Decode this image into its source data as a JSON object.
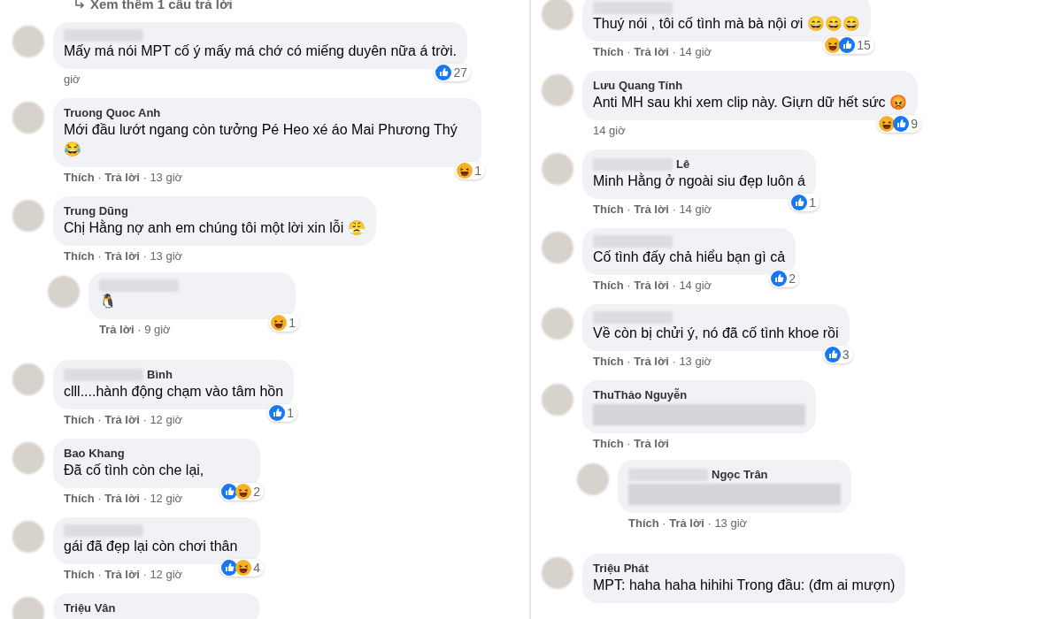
{
  "columns": [
    {
      "more_replies": {
        "label": "Xem thêm 1 câu trả lời"
      },
      "comments": [
        {
          "author_hidden": true,
          "text": "Mấy má nói MPT cố ý mấy má chớ có miếng duyên nữa á trời.",
          "reactions": {
            "icons": [
              {
                "kind": "like"
              }
            ],
            "count": "27"
          },
          "actions": "giờ"
        },
        {
          "author": "Truong Quoc Anh",
          "text": "Mới đầu lướt ngang còn tưởng Pé Heo xé áo Mai Phương Thý 😂",
          "reactions": {
            "icons": [
              {
                "kind": "haha"
              }
            ],
            "count": "1"
          },
          "actions": "**Thích** · **Trả lời** · 13 giờ"
        },
        {
          "author": "Trung Dũng",
          "text": "Chị Hằng nợ anh em chúng tôi một lời xin lỗi 😤",
          "actions": "**Thích** · **Trả lời** · 13 giờ",
          "children": [
            {
              "author_hidden": true,
              "text": "🐧",
              "reactions": {
                "icons": [
                  {
                    "kind": "haha"
                  }
                ],
                "count": "1"
              },
              "actions": "**Trả lời** · 9 giờ"
            }
          ]
        },
        {
          "author": "Bình",
          "author_hidden": true,
          "text": "clll....hành động chạm vào tâm hồn",
          "reactions": {
            "icons": [
              {
                "kind": "like"
              }
            ],
            "count": "1"
          },
          "actions": "**Thích** · **Trả lời** · 12 giờ"
        },
        {
          "author": "Bao Khang",
          "text": "Đã cố tình còn che lại,",
          "reactions": {
            "icons": [
              {
                "kind": "like"
              },
              {
                "kind": "haha"
              }
            ],
            "count": "2"
          },
          "actions": "**Thích** · **Trả lời** · 12 giờ"
        },
        {
          "author_hidden": true,
          "text": "gái đã đẹp lại còn chơi thân",
          "reactions": {
            "icons": [
              {
                "kind": "like"
              },
              {
                "kind": "haha"
              }
            ],
            "count": "4"
          },
          "actions": "**Thích** · **Trả lời** · 12 giờ"
        },
        {
          "author": "Triệu Vân"
        }
      ]
    },
    {
      "comments": [
        {
          "author_hidden": true,
          "text": "Thuý nói , tôi cố tình mà bà nội ơi 😄😄😄",
          "reactions": {
            "icons": [
              {
                "kind": "haha"
              },
              {
                "kind": "like"
              }
            ],
            "count": "15"
          },
          "actions": "**Thích** · **Trả lời** · 14 giờ"
        },
        {
          "author": "Lưu Quang Tính",
          "text": "Anti MH sau khi xem clip này. Giựn dữ hết sức 😡",
          "reactions": {
            "icons": [
              {
                "kind": "haha"
              },
              {
                "kind": "like"
              }
            ],
            "count": "9"
          },
          "actions": "14 giờ"
        },
        {
          "author": "Lê",
          "author_hidden": true,
          "text": "Minh Hằng ở ngoài siu đẹp luôn á",
          "reactions": {
            "icons": [
              {
                "kind": "like"
              }
            ],
            "count": "1"
          },
          "actions": "**Thích** · **Trả lời** · 14 giờ"
        },
        {
          "author_hidden": true,
          "text": "Cố tình đấy chả hiểu bạn gì cả",
          "reactions": {
            "icons": [
              {
                "kind": "like"
              }
            ],
            "count": "2"
          },
          "actions": "**Thích** · **Trả lời** · 14 giờ"
        },
        {
          "author_hidden": true,
          "text": "Về còn bị chửi ý, nó đã cố tình khoe rồi",
          "reactions": {
            "icons": [
              {
                "kind": "like"
              }
            ],
            "count": "3"
          },
          "actions": "**Thích** · **Trả lời** · 13 giờ"
        },
        {
          "author": "ThuThảo Nguyễn",
          "text_hidden": true,
          "actions": "**Thích** · **Trả lời**",
          "children": [
            {
              "author": "Ngọc Trân",
              "author_hidden": true,
              "text_hidden": true,
              "actions": "**Thích** · **Trả lời** · 13 giờ"
            }
          ]
        },
        {
          "author": "Triệu Phát",
          "text": "MPT: haha haha hihihi Trong đầu: (đm ai mượn)"
        }
      ]
    }
  ]
}
